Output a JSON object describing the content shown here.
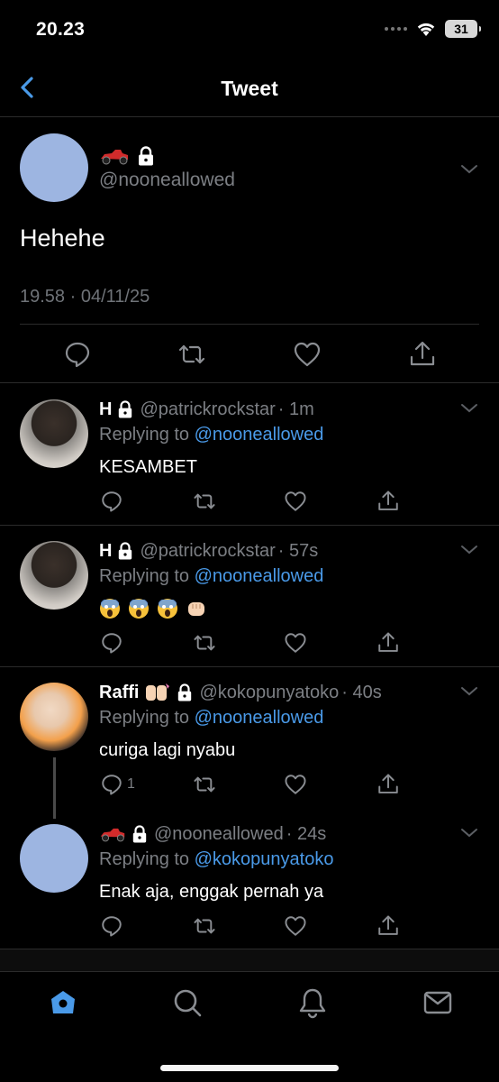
{
  "status_bar": {
    "time": "20.23",
    "battery": "31"
  },
  "header": {
    "title": "Tweet"
  },
  "main_tweet": {
    "handle": "@nooneallowed",
    "text": "Hehehe",
    "timestamp": "19.58 · 04/11/25"
  },
  "replies": [
    {
      "name": "H",
      "handle": "@patrickrockstar",
      "time": "· 1m",
      "replying_prefix": "Replying to ",
      "replying_to": "@nooneallowed",
      "text": "KESAMBET"
    },
    {
      "name": "H",
      "handle": "@patrickrockstar",
      "time": "· 57s",
      "replying_prefix": "Replying to ",
      "replying_to": "@nooneallowed",
      "text": ""
    },
    {
      "name": "Raffi",
      "handle": "@kokopunyatoko",
      "time": "· 40s",
      "replying_prefix": "Replying to ",
      "replying_to": "@nooneallowed",
      "text": "curiga lagi nyabu",
      "reply_count": "1"
    },
    {
      "name": "",
      "handle": "@nooneallowed",
      "time": "· 24s",
      "replying_prefix": "Replying to ",
      "replying_to": "@kokopunyatoko",
      "text": "Enak aja, enggak pernah ya"
    }
  ],
  "colors": {
    "accent": "#4a9ae8",
    "muted": "#7c7f84",
    "avatar_blank": "#9db5e1"
  },
  "tabs": [
    "home-icon",
    "search-icon",
    "notifications-icon",
    "messages-icon"
  ]
}
